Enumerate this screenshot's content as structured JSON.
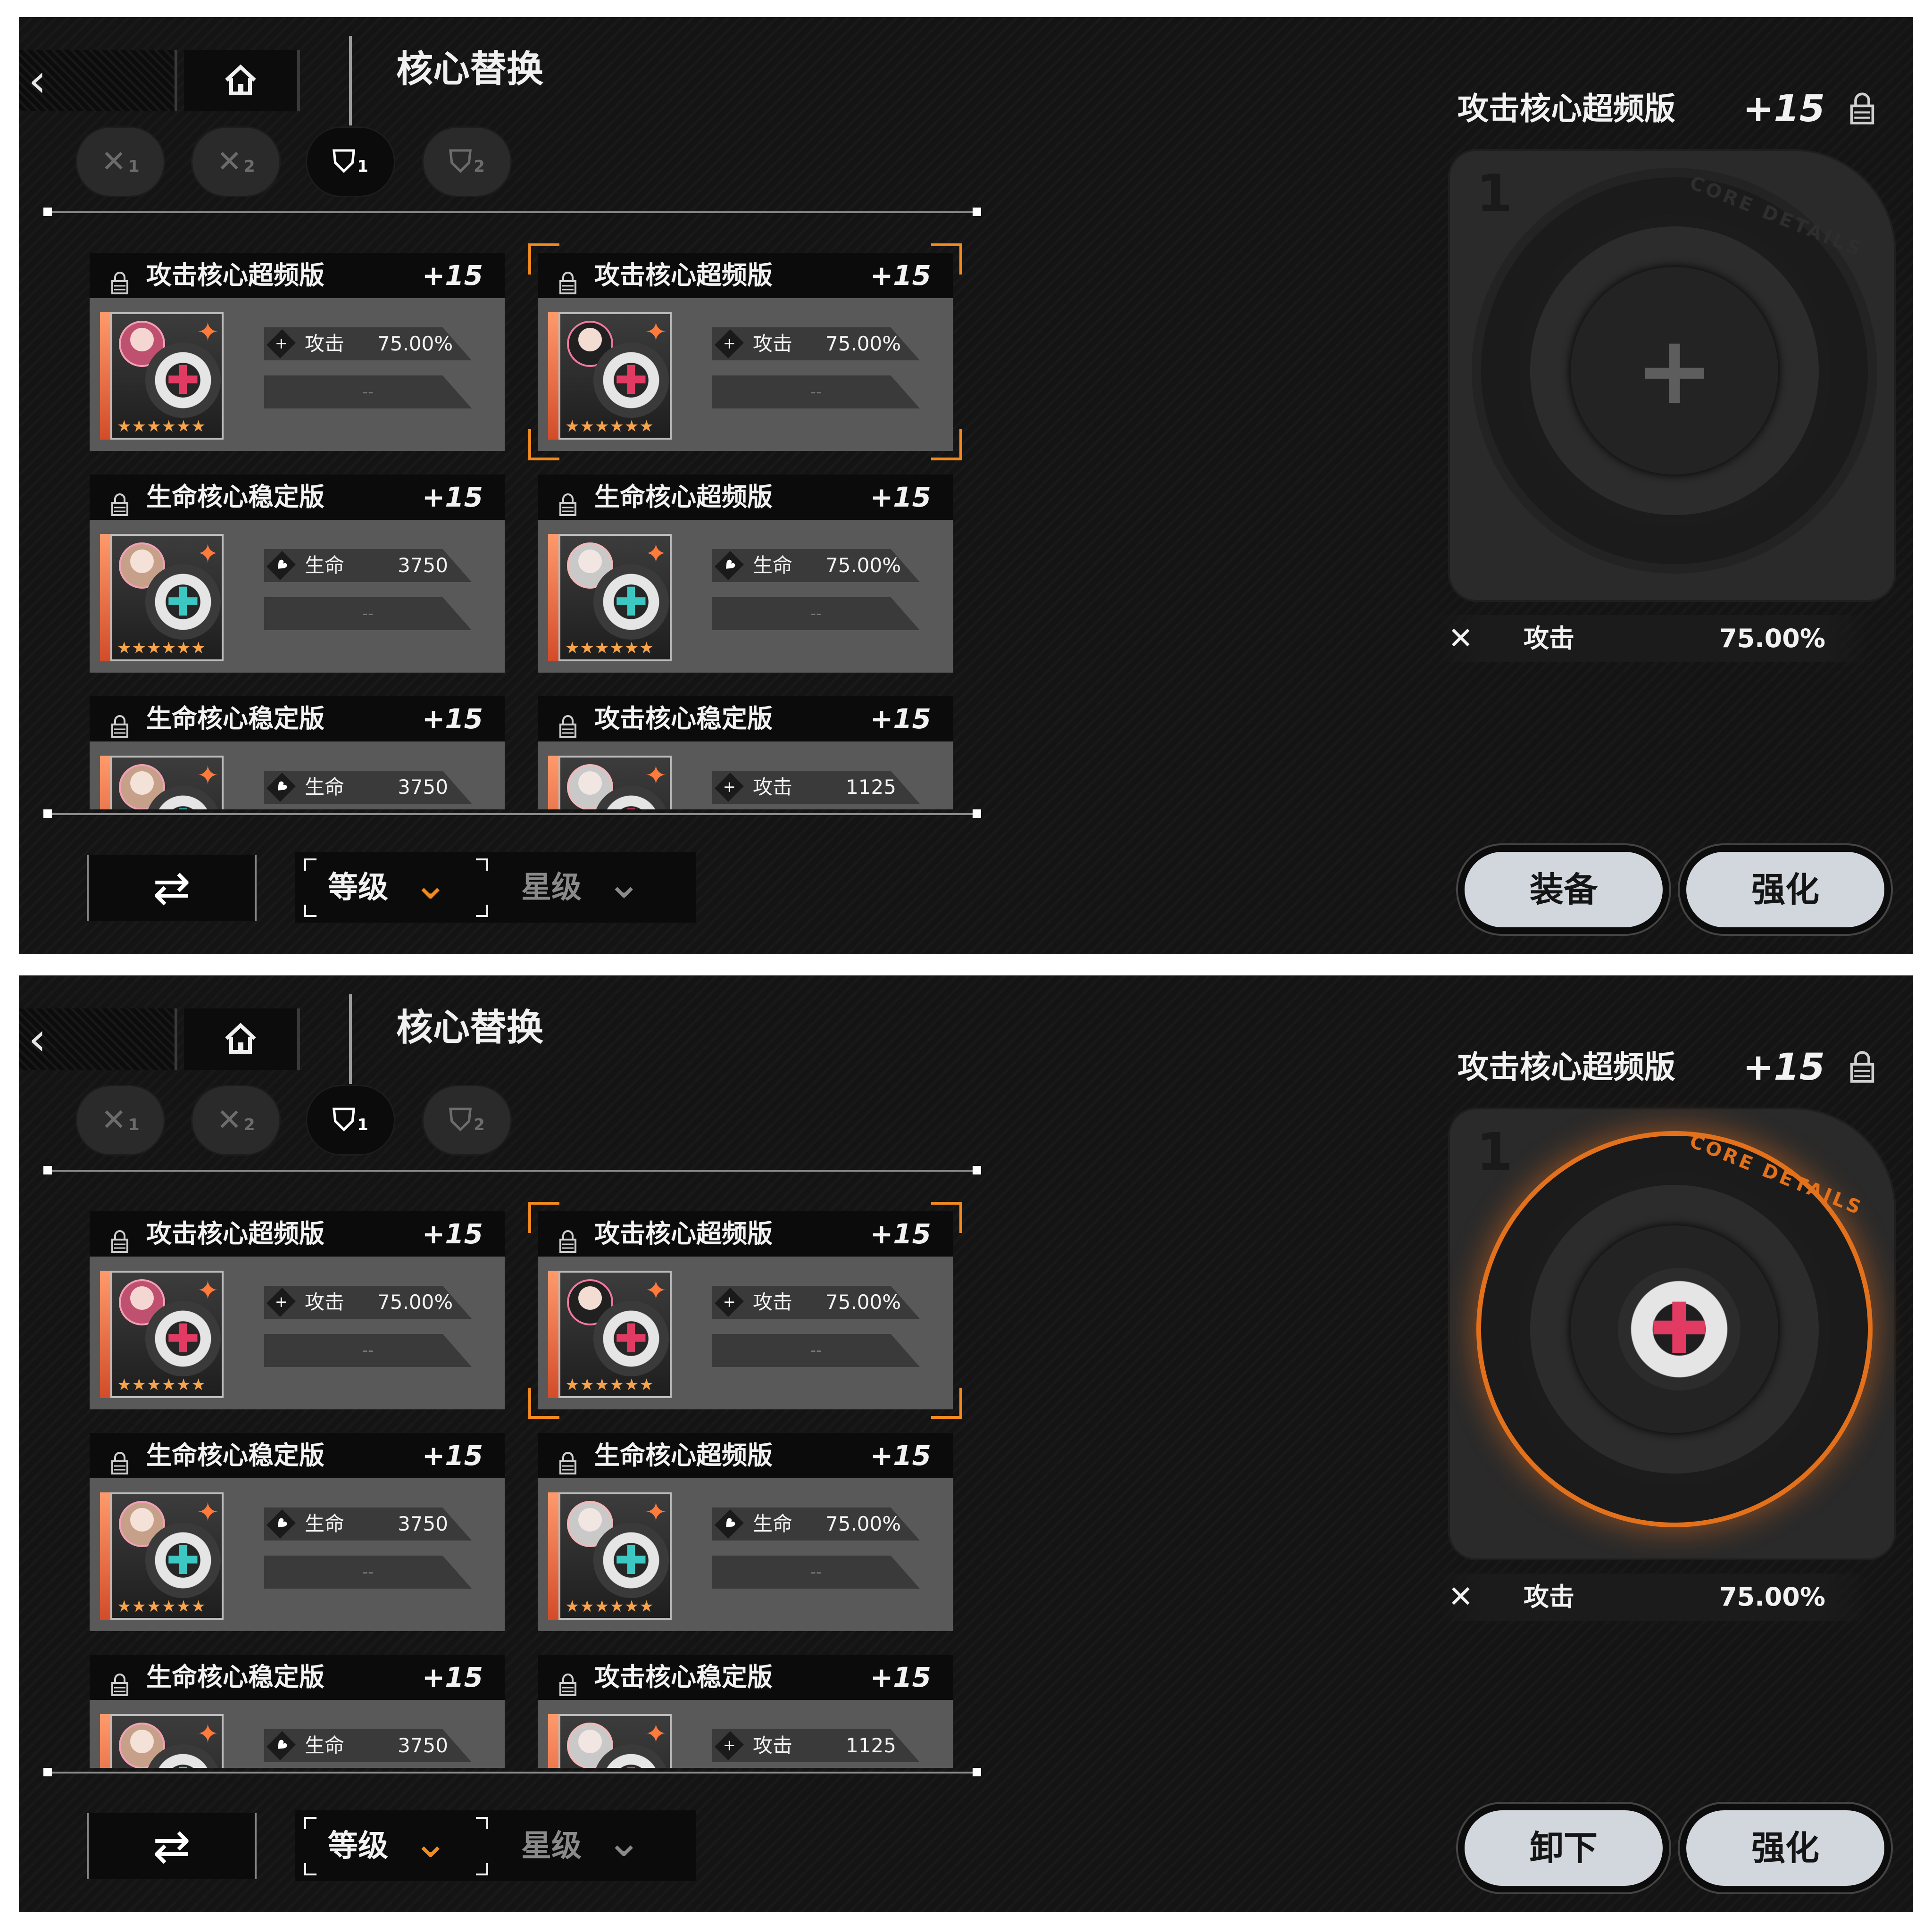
{
  "colors": {
    "accent_orange": "#f28a1e",
    "panel_bg": "#141414",
    "card_head_bg": "#0b0b0b",
    "card_body_bg": "#595959",
    "button_bg": "#d2d7de"
  },
  "screens": [
    {
      "nav": {
        "back_icon": "chevron-left-icon",
        "home_icon": "home-icon",
        "title": "核心替换"
      },
      "filters": [
        {
          "icon": "attack-icon",
          "num": "1",
          "active": false
        },
        {
          "icon": "attack-icon",
          "num": "2",
          "active": false
        },
        {
          "icon": "shield-icon",
          "num": "1",
          "active": true
        },
        {
          "icon": "shield-icon",
          "num": "2",
          "active": false
        }
      ],
      "cards": [
        {
          "name": "攻击核心超频版",
          "level": "+15",
          "stat_label": "攻击",
          "stat_value": "75.00%",
          "empty": "--",
          "type": "attack",
          "selected": false
        },
        {
          "name": "攻击核心超频版",
          "level": "+15",
          "stat_label": "攻击",
          "stat_value": "75.00%",
          "empty": "--",
          "type": "attack",
          "selected": true
        },
        {
          "name": "生命核心稳定版",
          "level": "+15",
          "stat_label": "生命",
          "stat_value": "3750",
          "empty": "--",
          "type": "hp",
          "selected": false
        },
        {
          "name": "生命核心超频版",
          "level": "+15",
          "stat_label": "生命",
          "stat_value": "75.00%",
          "empty": "--",
          "type": "hp",
          "selected": false
        },
        {
          "name": "生命核心稳定版",
          "level": "+15",
          "stat_label": "生命",
          "stat_value": "3750",
          "empty": "--",
          "type": "hp",
          "selected": false
        },
        {
          "name": "攻击核心稳定版",
          "level": "+15",
          "stat_label": "攻击",
          "stat_value": "1125",
          "empty": "--",
          "type": "attack",
          "selected": false
        }
      ],
      "sort": {
        "swap_icon": "swap-arrows-icon",
        "level_label": "等级",
        "star_label": "星级"
      },
      "detail": {
        "title": "攻击核心超频版",
        "level": "+15",
        "slot_number": "1",
        "ring_text": "CORE DETAILS",
        "equipped": false,
        "stat_label": "攻击",
        "stat_value": "75.00%"
      },
      "buttons": {
        "primary": "装备",
        "enhance": "强化"
      }
    },
    {
      "nav": {
        "back_icon": "chevron-left-icon",
        "home_icon": "home-icon",
        "title": "核心替换"
      },
      "filters": [
        {
          "icon": "attack-icon",
          "num": "1",
          "active": false
        },
        {
          "icon": "attack-icon",
          "num": "2",
          "active": false
        },
        {
          "icon": "shield-icon",
          "num": "1",
          "active": true
        },
        {
          "icon": "shield-icon",
          "num": "2",
          "active": false
        }
      ],
      "cards": [
        {
          "name": "攻击核心超频版",
          "level": "+15",
          "stat_label": "攻击",
          "stat_value": "75.00%",
          "empty": "--",
          "type": "attack",
          "selected": false
        },
        {
          "name": "攻击核心超频版",
          "level": "+15",
          "stat_label": "攻击",
          "stat_value": "75.00%",
          "empty": "--",
          "type": "attack",
          "selected": true
        },
        {
          "name": "生命核心稳定版",
          "level": "+15",
          "stat_label": "生命",
          "stat_value": "3750",
          "empty": "--",
          "type": "hp",
          "selected": false
        },
        {
          "name": "生命核心超频版",
          "level": "+15",
          "stat_label": "生命",
          "stat_value": "75.00%",
          "empty": "--",
          "type": "hp",
          "selected": false
        },
        {
          "name": "生命核心稳定版",
          "level": "+15",
          "stat_label": "生命",
          "stat_value": "3750",
          "empty": "--",
          "type": "hp",
          "selected": false
        },
        {
          "name": "攻击核心稳定版",
          "level": "+15",
          "stat_label": "攻击",
          "stat_value": "1125",
          "empty": "--",
          "type": "attack",
          "selected": false
        }
      ],
      "sort": {
        "swap_icon": "swap-arrows-icon",
        "level_label": "等级",
        "star_label": "星级"
      },
      "detail": {
        "title": "攻击核心超频版",
        "level": "+15",
        "slot_number": "1",
        "ring_text": "CORE DETAILS",
        "equipped": true,
        "stat_label": "攻击",
        "stat_value": "75.00%"
      },
      "buttons": {
        "primary": "卸下",
        "enhance": "强化"
      }
    }
  ]
}
